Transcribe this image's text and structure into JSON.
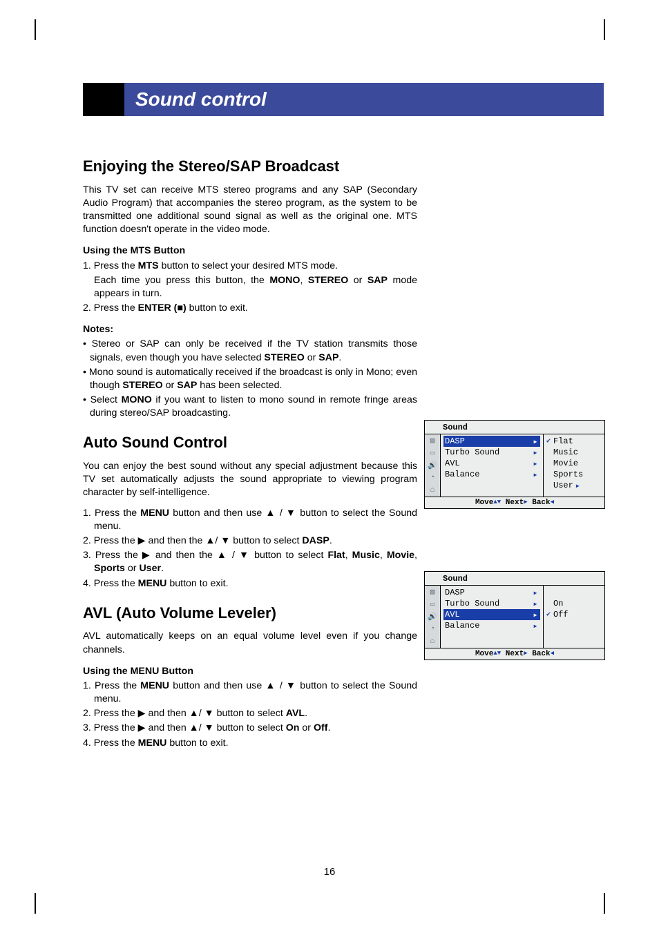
{
  "title_bar": "Sound control",
  "sec1": {
    "heading": "Enjoying the Stereo/SAP Broadcast",
    "intro": "This TV set can receive MTS stereo programs and any SAP (Secondary Audio Program) that accompanies the stereo program, as the system to be transmitted one additional sound signal as well as the original one. MTS function doesn't operate in the video mode.",
    "sub1": "Using the MTS Button",
    "s1l1a": "1. Press the ",
    "s1l1b": "MTS",
    "s1l1c": " button to select your desired MTS mode.",
    "s1l1d": "Each time you press this button, the ",
    "s1l1e": "MONO",
    "s1l1f": ", ",
    "s1l1g": "STEREO",
    "s1l1h": " or ",
    "s1l1i": "SAP",
    "s1l1j": " mode appears in turn.",
    "s1l2a": "2. Press the ",
    "s1l2b": "ENTER (■)",
    "s1l2c": " button to exit.",
    "notes": "Notes:",
    "n1a": "• Stereo or SAP can only be received if the TV station transmits those signals, even though you have selected ",
    "n1b": "STEREO",
    "n1c": " or ",
    "n1d": "SAP",
    "n1e": ".",
    "n2a": "• Mono sound is automatically received if the broadcast is only in Mono; even though ",
    "n2b": "STEREO",
    "n2c": " or ",
    "n2d": "SAP",
    "n2e": " has been selected.",
    "n3a": "• Select ",
    "n3b": "MONO",
    "n3c": " if you want to listen to mono sound in remote fringe areas during stereo/SAP broadcasting."
  },
  "sec2": {
    "heading": "Auto Sound Control",
    "intro": "You can enjoy the best sound without any special adjustment because this TV set automatically adjusts the sound appropriate to viewing program character by self-intelligence.",
    "l1a": "1. Press the ",
    "l1b": "MENU",
    "l1c": " button and then use ▲ / ▼ button to select the Sound menu.",
    "l2a": "2. Press the ▶ and then the ▲/ ▼ button to select ",
    "l2b": "DASP",
    "l2c": ".",
    "l3a": "3. Press the ▶ and then the ▲ / ▼ button to select ",
    "l3b": "Flat",
    "l3c": ", ",
    "l3d": "Music",
    "l3e": ", ",
    "l3f": "Movie",
    "l3g": ", ",
    "l3h": "Sports",
    "l3i": " or ",
    "l3j": "User",
    "l3k": ".",
    "l4a": "4. Press the ",
    "l4b": "MENU",
    "l4c": " button to exit."
  },
  "sec3": {
    "heading": "AVL (Auto Volume Leveler)",
    "intro": "AVL automatically keeps on an equal volume level even if you change channels.",
    "sub1": "Using the MENU Button",
    "l1a": "1. Press the ",
    "l1b": "MENU",
    "l1c": " button and then use ▲ / ▼ button to select the Sound menu.",
    "l2a": "2. Press the ▶ and then ▲/ ▼ button to select ",
    "l2b": "AVL",
    "l2c": ".",
    "l3a": "3. Press the ▶ and then ▲/ ▼ button to select ",
    "l3b": "On",
    "l3c": " or ",
    "l3d": "Off",
    "l3e": ".",
    "l4a": "4. Press the ",
    "l4b": "MENU",
    "l4c": " button to exit."
  },
  "osd1": {
    "title": "Sound",
    "items": [
      "DASP",
      "Turbo Sound",
      "AVL",
      "Balance"
    ],
    "sub": [
      "Flat",
      "Music",
      "Movie",
      "Sports",
      "User"
    ],
    "foot_move": "Move",
    "foot_next": "Next",
    "foot_back": "Back"
  },
  "osd2": {
    "title": "Sound",
    "items": [
      "DASP",
      "Turbo Sound",
      "AVL",
      "Balance"
    ],
    "sub": [
      "On",
      "Off"
    ],
    "foot_move": "Move",
    "foot_next": "Next",
    "foot_back": "Back"
  },
  "page_number": "16"
}
